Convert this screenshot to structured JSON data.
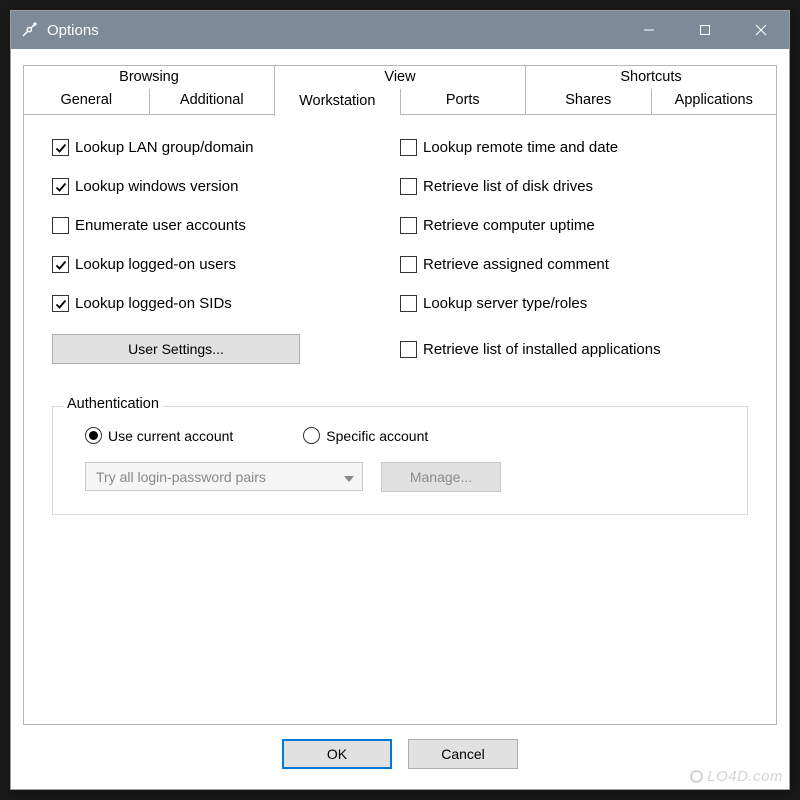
{
  "window": {
    "title": "Options"
  },
  "tabs": {
    "top": [
      "Browsing",
      "View",
      "Shortcuts"
    ],
    "bottom": [
      "General",
      "Additional",
      "Workstation",
      "Ports",
      "Shares",
      "Applications"
    ],
    "active": "Workstation"
  },
  "options": {
    "left": [
      {
        "label": "Lookup LAN group/domain",
        "checked": true
      },
      {
        "label": "Lookup windows version",
        "checked": true
      },
      {
        "label": "Enumerate user accounts",
        "checked": false
      },
      {
        "label": "Lookup logged-on users",
        "checked": true
      },
      {
        "label": "Lookup logged-on SIDs",
        "checked": true
      }
    ],
    "right": [
      {
        "label": "Lookup remote time and date",
        "checked": false
      },
      {
        "label": "Retrieve list of disk drives",
        "checked": false
      },
      {
        "label": "Retrieve computer uptime",
        "checked": false
      },
      {
        "label": "Retrieve assigned comment",
        "checked": false
      },
      {
        "label": "Lookup server type/roles",
        "checked": false
      },
      {
        "label": "Retrieve list of installed applications",
        "checked": false
      }
    ],
    "user_settings_button": "User Settings..."
  },
  "auth": {
    "legend": "Authentication",
    "radios": {
      "current": "Use current account",
      "specific": "Specific account",
      "selected": "current"
    },
    "combo_value": "Try all login-password pairs",
    "manage_button": "Manage..."
  },
  "buttons": {
    "ok": "OK",
    "cancel": "Cancel"
  },
  "watermark": "LO4D.com"
}
